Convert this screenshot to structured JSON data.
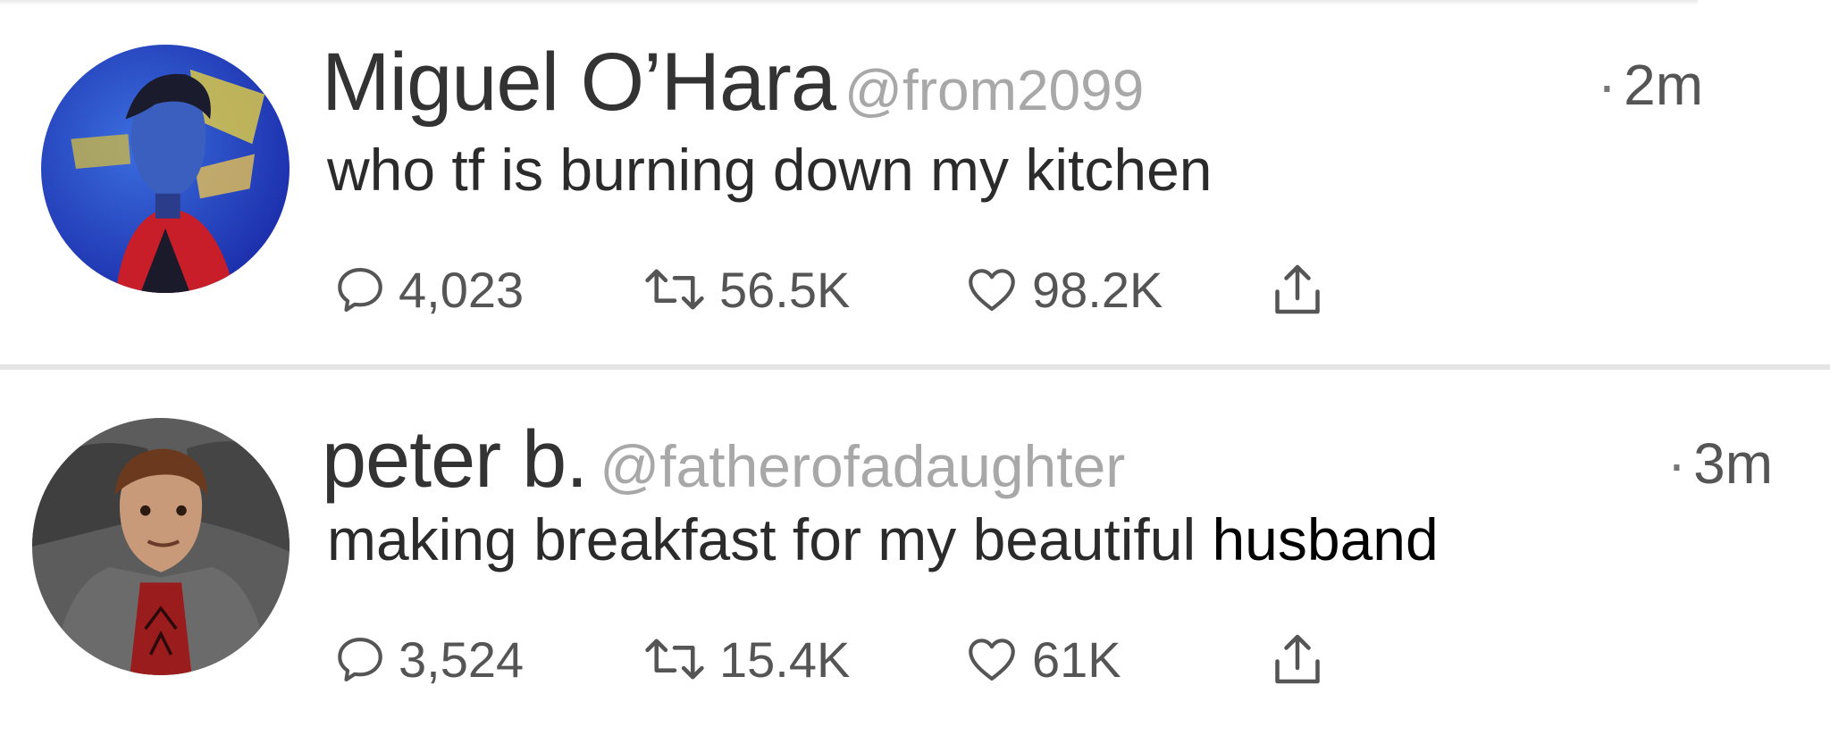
{
  "tweets": [
    {
      "display_name": "Miguel O’Hara",
      "handle": "@from2099",
      "time_separator": "·",
      "time": "2m",
      "text": "who tf is burning down my kitchen",
      "replies": "4,023",
      "retweets": "56.5K",
      "likes": "98.2K"
    },
    {
      "display_name": "peter b.",
      "handle": "@fatherofadaughter",
      "time_separator": "·",
      "time": "3m",
      "text": "making breakfast for my beautiful",
      "text_edited": "husband",
      "replies": "3,524",
      "retweets": "15.4K",
      "likes": "61K"
    }
  ],
  "icons": {
    "reply": "reply-icon",
    "retweet": "retweet-icon",
    "like": "heart-icon",
    "share": "share-icon"
  },
  "colors": {
    "name": "#333333",
    "handle": "#a8a8a8",
    "counts": "#555555",
    "divider": "#e6e6e6"
  }
}
